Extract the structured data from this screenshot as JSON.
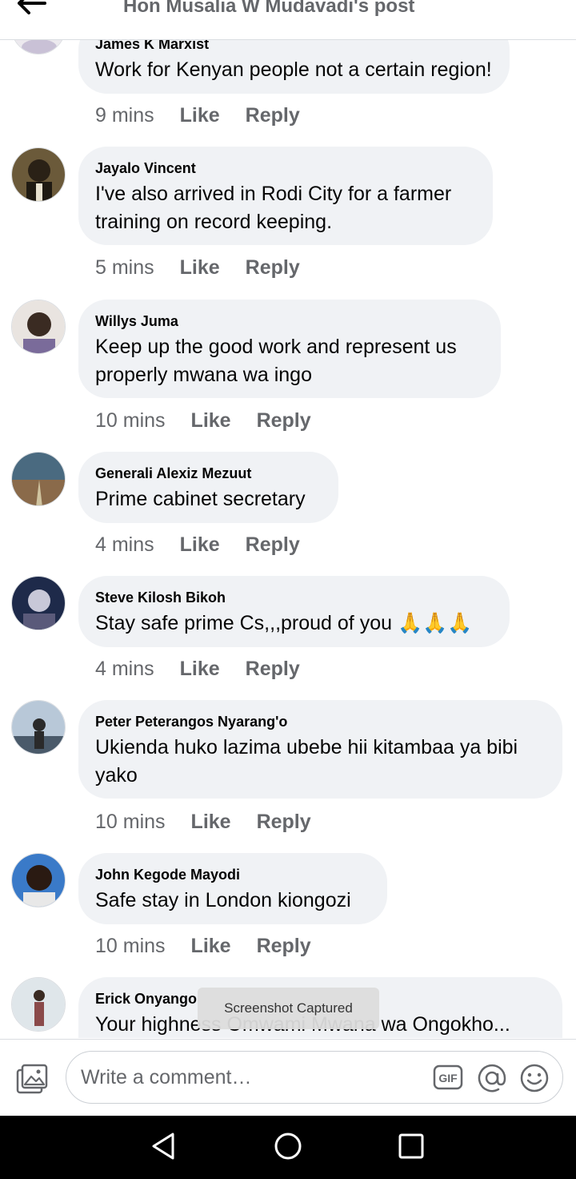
{
  "header": {
    "title": "Hon Musalia W Mudavadi's post"
  },
  "actions": {
    "like": "Like",
    "reply": "Reply"
  },
  "comments": [
    {
      "author": "James K Marxist",
      "text": "Work for Kenyan people not a certain region!",
      "time": "9 mins"
    },
    {
      "author": "Jayalo Vincent",
      "text": "I've also arrived in Rodi City for a farmer training on record keeping.",
      "time": "5 mins"
    },
    {
      "author": "Willys Juma",
      "text": "Keep up the good work  and represent us properly mwana wa ingo",
      "time": "10 mins"
    },
    {
      "author": "Generali Alexiz Mezuut",
      "text": "Prime cabinet secretary",
      "time": "4 mins"
    },
    {
      "author": "Steve Kilosh Bikoh",
      "text": "Stay safe prime Cs,,,proud of you 🙏🙏🙏",
      "time": "4 mins"
    },
    {
      "author": "Peter Peterangos Nyarang'o",
      "text": "Ukienda huko lazima ubebe hii kitambaa ya bibi yako",
      "time": "10 mins"
    },
    {
      "author": "John Kegode Mayodi",
      "text": "Safe stay in London kiongozi",
      "time": "10 mins"
    },
    {
      "author": "Erick Onyango",
      "text": "Your highness Omwami Mwana wa  Ongokho..."
    }
  ],
  "toast": "Screenshot Captured",
  "composer": {
    "placeholder": "Write a comment…",
    "icons": [
      "photo-icon",
      "gif-icon",
      "mention-icon",
      "emoji-icon"
    ]
  },
  "system_nav": {
    "icons": [
      "nav-back-icon",
      "nav-home-icon",
      "nav-recents-icon"
    ]
  },
  "colors": {
    "bubble": "#f0f2f5",
    "meta_text": "#65676b",
    "nav_bar": "#000000"
  }
}
